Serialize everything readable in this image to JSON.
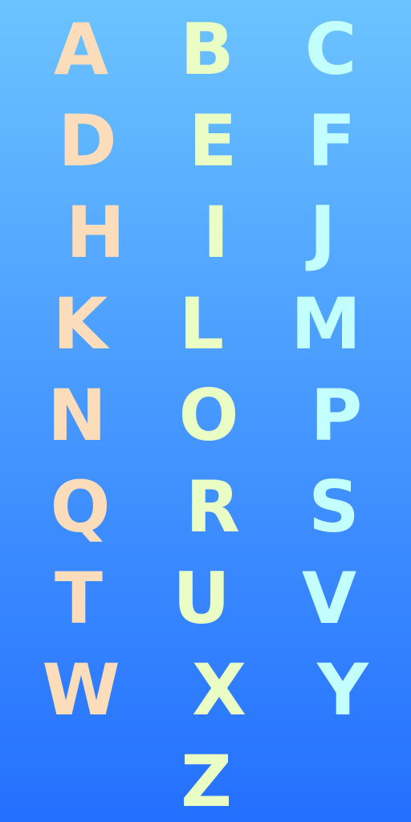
{
  "colors": {
    "background_top": "#6cc3ff",
    "background_bottom": "#2470ff",
    "left_column": "#fbdcbb",
    "middle_column": "#e9fdc5",
    "right_column": "#c4ffff"
  },
  "letters": [
    "A",
    "B",
    "C",
    "D",
    "E",
    "F",
    "H",
    "I",
    "J",
    "K",
    "L",
    "M",
    "N",
    "O",
    "P",
    "Q",
    "R",
    "S",
    "T",
    "U",
    "V",
    "W",
    "X",
    "Y",
    "Z"
  ]
}
